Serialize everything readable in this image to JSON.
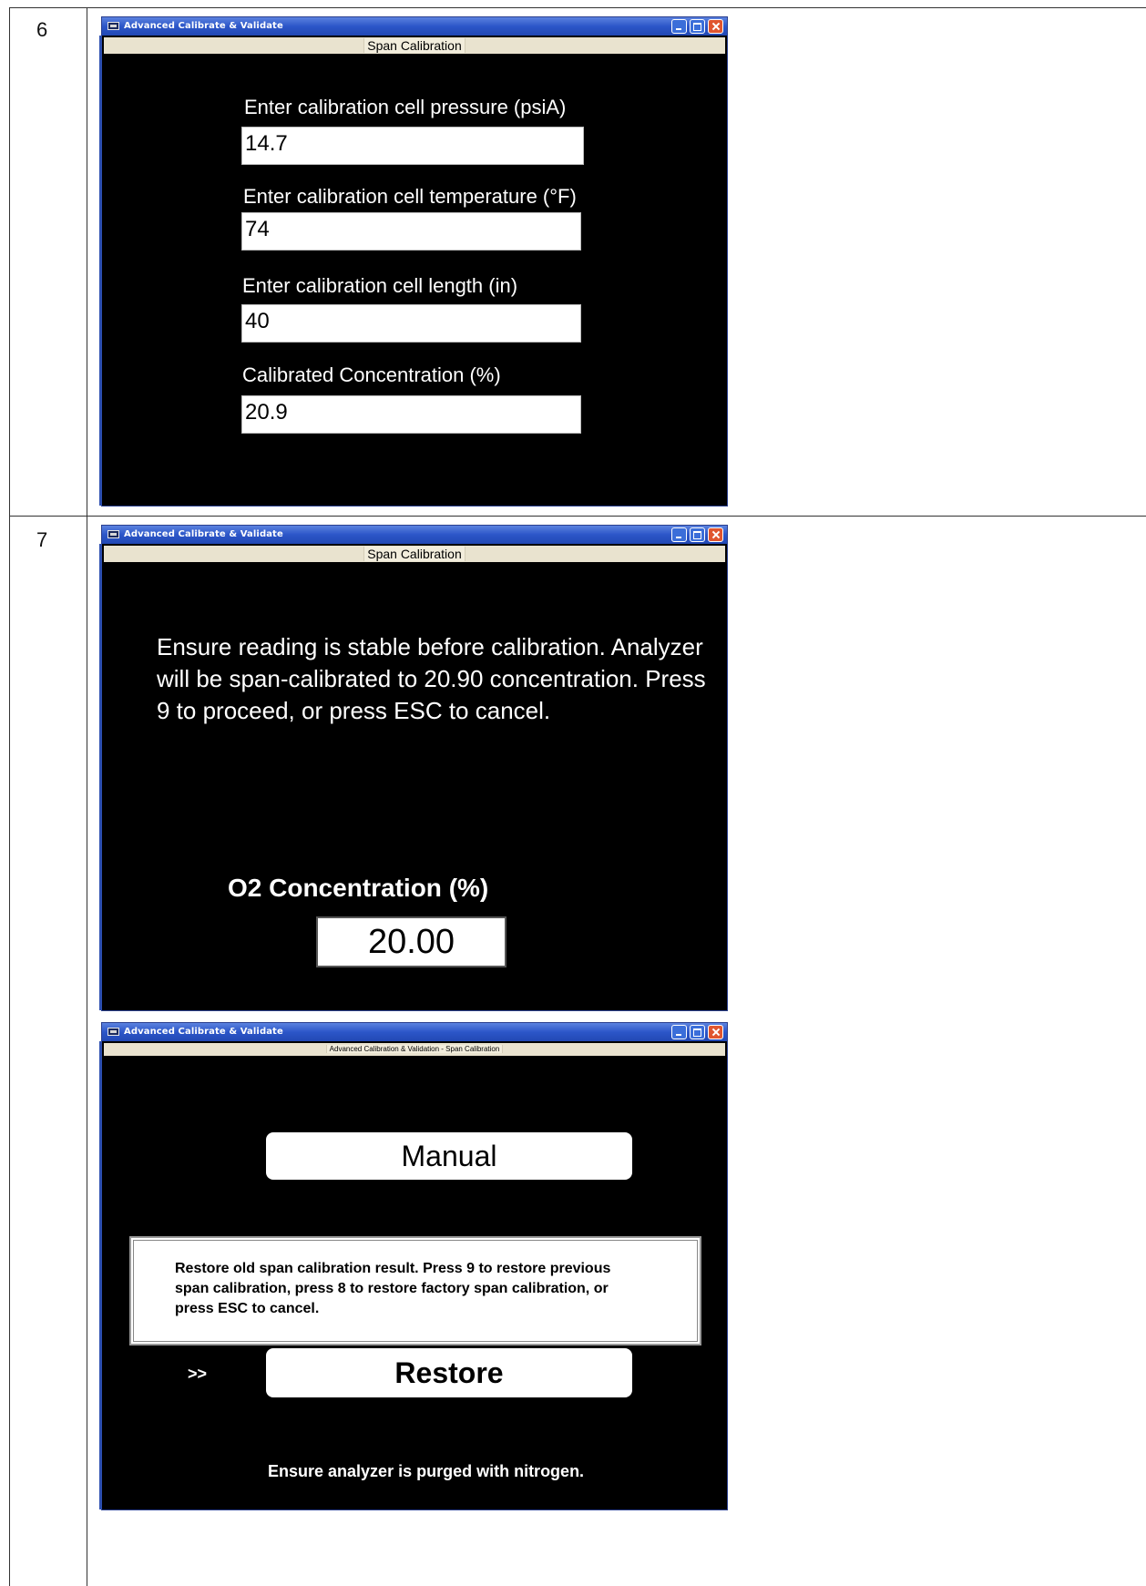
{
  "steps": [
    {
      "number": "6"
    },
    {
      "number": "7"
    }
  ],
  "window1": {
    "title": "Advanced Calibrate & Validate",
    "menu_title": "Span Calibration",
    "fields": [
      {
        "label": "Enter calibration cell pressure (psiA)",
        "value": "14.7"
      },
      {
        "label": "Enter calibration cell temperature (°F)",
        "value": "74"
      },
      {
        "label": "Enter calibration cell length (in)",
        "value": "40"
      },
      {
        "label": "Calibrated Concentration (%)",
        "value": "20.9"
      }
    ]
  },
  "window2": {
    "title": "Advanced Calibrate & Validate",
    "menu_title": "Span Calibration",
    "message": "Ensure reading is stable before calibration. Analyzer will be span-calibrated to 20.90 concentration. Press 9 to proceed, or press ESC to cancel.",
    "concentration_label": "O2 Concentration (%)",
    "concentration_value": "20.00"
  },
  "window3": {
    "title": "Advanced Calibrate & Validate",
    "menu_title": "Advanced Calibration & Validation - Span Calibration",
    "manual_label": "Manual",
    "dialog_text": "Restore old span calibration result. Press 9 to restore previous span calibration, press 8 to restore factory span calibration, or press ESC to cancel.",
    "arrow": ">>",
    "restore_label": "Restore",
    "footer": "Ensure analyzer is purged with nitrogen."
  },
  "colors": {
    "titlebar": "#2c56c8",
    "window_bg": "#000000",
    "menubar": "#e9e3cf",
    "close_button": "#e0552f"
  }
}
